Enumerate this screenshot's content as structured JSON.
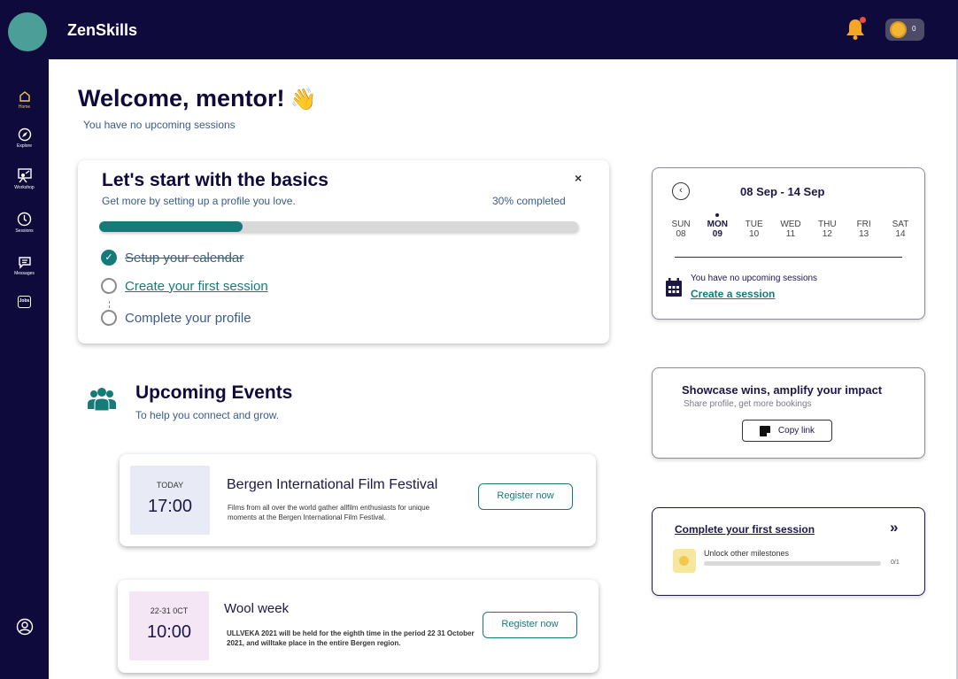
{
  "app": {
    "brand": "ZenSkills",
    "coin_count": "0",
    "accent": "#157b78",
    "navy": "#0f0a3c"
  },
  "sidebar": {
    "items": [
      {
        "label": "Home",
        "icon": "home-icon"
      },
      {
        "label": "Explore",
        "icon": "compass-icon"
      },
      {
        "label": "Workshop",
        "icon": "workshop-icon"
      },
      {
        "label": "Sessions",
        "icon": "clock-icon"
      },
      {
        "label": "Messages",
        "icon": "message-icon"
      },
      {
        "label": "Jobs",
        "icon": "jobs-icon"
      }
    ],
    "profile_icon": "user-circle-icon"
  },
  "header": {
    "welcome": "Welcome, mentor!",
    "wave_emoji": "👋",
    "subtitle": "You have no upcoming sessions"
  },
  "basics": {
    "title": "Let's start with the basics",
    "subtitle": "Get more by setting up a profile you love.",
    "progress_label": "30% completed",
    "progress": 0.3,
    "close": "×",
    "steps": [
      {
        "label": "Setup your calendar",
        "state": "done"
      },
      {
        "label": "Create your first session",
        "state": "link"
      },
      {
        "label": "Complete your profile",
        "state": "todo"
      }
    ]
  },
  "events": {
    "title": "Upcoming Events",
    "subtitle": "To help you connect and grow.",
    "items": [
      {
        "date_label": "TODAY",
        "time": "17:00",
        "title": "Bergen International Film Festival",
        "description": "Films from all over the world gather allfilm enthusiasts for unique moments at the Bergen International Film Festival.",
        "button": "Register now",
        "color": "#e8ebf5"
      },
      {
        "date_label": "22-31 0CT",
        "time": "10:00",
        "title": "Wool week",
        "description": "ULLVEKA 2021 will be held for the eighth time in the period 22 31 October 2021, and willtake place in the entire Bergen region.",
        "button": "Register now",
        "color": "#f5e6f5"
      }
    ]
  },
  "calendar": {
    "range": "08 Sep - 14 Sep",
    "back_icon": "chevron-left-icon",
    "days": [
      {
        "name": "SUN",
        "num": "08"
      },
      {
        "name": "MON",
        "num": "09"
      },
      {
        "name": "TUE",
        "num": "10"
      },
      {
        "name": "WED",
        "num": "11"
      },
      {
        "name": "THU",
        "num": "12"
      },
      {
        "name": "FRI",
        "num": "13"
      },
      {
        "name": "SAT",
        "num": "14"
      }
    ],
    "today_index": 1,
    "empty_text": "You have no upcoming sessions",
    "create_link": "Create a session"
  },
  "showcase": {
    "title": "Showcase wins, amplify your impact",
    "subtitle": "Share profile, get more bookings",
    "button": "Copy link"
  },
  "milestone": {
    "title": "Complete your first session",
    "arrows": "»",
    "label": "Unlock other milestones",
    "count": "0/1",
    "progress": 0
  }
}
